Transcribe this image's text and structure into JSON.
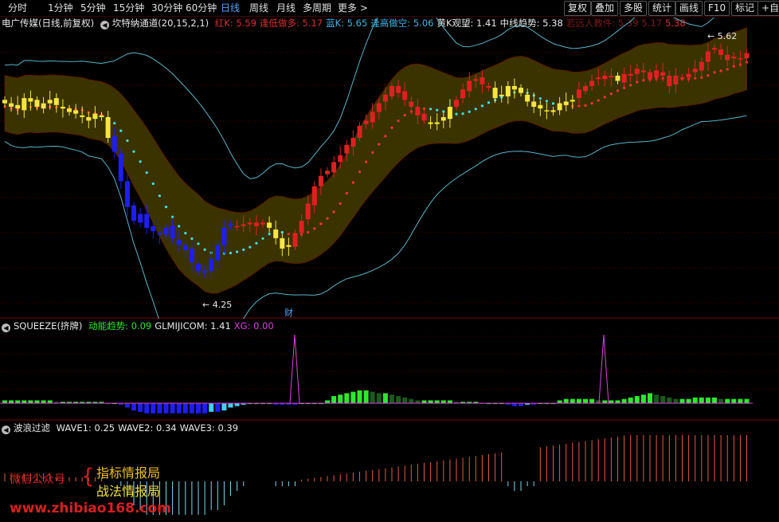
{
  "toolbar": {
    "periods": [
      "分时",
      "1分钟",
      "5分钟",
      "15分钟",
      "30分钟",
      "60分钟",
      "日线",
      "周线",
      "月线",
      "多周期",
      "更多 >"
    ],
    "active_period": "日线",
    "buttons": [
      "复权",
      "叠加",
      "多股",
      "统计",
      "画线",
      "F10",
      "标记",
      "+自选"
    ]
  },
  "main_panel": {
    "stock_title": "电广传媒(日线,前复权)",
    "indicator_name": "坎特纳通道(20,15,2,1)",
    "legend": [
      {
        "label": "红K: 5.59",
        "color": "#d93030"
      },
      {
        "label": "逢低做多: 5.17",
        "color": "#d93030"
      },
      {
        "label": "蓝K: 5.65",
        "color": "#3cb4e6"
      },
      {
        "label": "逢高做空: 5.06",
        "color": "#3cb4e6"
      },
      {
        "label": "黄K观望: 1.41",
        "color": "#e8e8e8"
      },
      {
        "label": "中线趋势: 5.38",
        "color": "#e8e8e8"
      },
      {
        "label": "若远人教件: 5.39",
        "color": "#7a1a1a"
      },
      {
        "label": "5.17",
        "color": "#7a1a1a"
      },
      {
        "label": "5.38",
        "color": "#d93030"
      }
    ],
    "high_label": "5.62",
    "low_label": "4.25",
    "event_marker": "财"
  },
  "squeeze_panel": {
    "title": "SQUEEZE(挤牌)",
    "legend": [
      {
        "label": "动能趋势: 0.09",
        "color": "#2ee82e"
      },
      {
        "label": "GLMIJICOM: 1.41",
        "color": "#e8e8e8"
      },
      {
        "label": "XG: 0.00",
        "color": "#e040e0"
      }
    ]
  },
  "wave_panel": {
    "title": "波浪过滤",
    "legend": [
      {
        "label": "WAVE1: 0.25",
        "color": "#e8e8e8"
      },
      {
        "label": "WAVE2: 0.34",
        "color": "#e8e8e8"
      },
      {
        "label": "WAVE3: 0.39",
        "color": "#e8e8e8"
      }
    ]
  },
  "watermark": {
    "line1_left": "微信公众号",
    "line1_right": "指标情报局",
    "line2_right": "战法情报局",
    "url": "www.zhibiao168.com"
  },
  "colors": {
    "up_red": "#e02020",
    "down_blue": "#1e1ef0",
    "neutral_yellow": "#f5e642",
    "channel_fill": "#3a3300",
    "cyan_line": "#5ab4c8",
    "magenta": "#e040e0",
    "green": "#2ee82e",
    "dark_green": "#1a5a1a",
    "grid_red": "#5a0000"
  },
  "chart_data": {
    "type": "candlestick",
    "price_range": [
      4.1,
      5.75
    ],
    "candles_close": [
      5.3,
      5.28,
      5.27,
      5.33,
      5.31,
      5.28,
      5.3,
      5.32,
      5.29,
      5.27,
      5.25,
      5.24,
      5.22,
      5.2,
      5.24,
      5.22,
      5.1,
      5.02,
      4.85,
      4.7,
      4.62,
      4.66,
      4.58,
      4.56,
      4.54,
      4.58,
      4.52,
      4.48,
      4.45,
      4.38,
      4.33,
      4.32,
      4.4,
      4.48,
      4.58,
      4.6,
      4.59,
      4.6,
      4.6,
      4.61,
      4.6,
      4.58,
      4.52,
      4.46,
      4.48,
      4.55,
      4.62,
      4.72,
      4.82,
      4.88,
      4.91,
      4.96,
      5.0,
      5.06,
      5.1,
      5.17,
      5.2,
      5.25,
      5.3,
      5.35,
      5.4,
      5.36,
      5.32,
      5.28,
      5.23,
      5.2,
      5.18,
      5.19,
      5.22,
      5.28,
      5.32,
      5.38,
      5.43,
      5.44,
      5.41,
      5.39,
      5.33,
      5.35,
      5.4,
      5.38,
      5.36,
      5.31,
      5.28,
      5.27,
      5.26,
      5.25,
      5.3,
      5.31,
      5.32,
      5.38,
      5.4,
      5.43,
      5.45,
      5.46,
      5.45,
      5.43,
      5.47,
      5.46,
      5.5,
      5.48,
      5.44,
      5.49,
      5.46,
      5.4,
      5.46,
      5.45,
      5.47,
      5.5,
      5.54,
      5.6,
      5.62,
      5.58,
      5.55,
      5.57,
      5.56,
      5.59
    ],
    "squeeze_values": [
      0.02,
      0.02,
      0.02,
      0.02,
      0.02,
      0.02,
      0.02,
      0.02,
      0.01,
      0.01,
      0.01,
      0.01,
      0.01,
      0.01,
      0.01,
      0.01,
      0.0,
      0.0,
      -0.01,
      -0.03,
      -0.05,
      -0.06,
      -0.07,
      -0.07,
      -0.07,
      -0.07,
      -0.07,
      -0.07,
      -0.07,
      -0.07,
      -0.07,
      -0.07,
      -0.06,
      -0.06,
      -0.05,
      -0.03,
      -0.02,
      -0.01,
      0.0,
      0.0,
      0.0,
      0.0,
      -0.01,
      -0.01,
      -0.01,
      -0.01,
      0.0,
      0.0,
      0.0,
      0.0,
      0.02,
      0.05,
      0.06,
      0.07,
      0.08,
      0.09,
      0.09,
      0.08,
      0.07,
      0.07,
      0.06,
      0.05,
      0.04,
      0.03,
      0.02,
      0.02,
      0.02,
      0.02,
      0.02,
      0.02,
      0.01,
      0.01,
      0.01,
      0.01,
      0.0,
      0.0,
      0.0,
      0.0,
      -0.01,
      -0.02,
      -0.02,
      -0.01,
      -0.01,
      0.0,
      0.0,
      0.0,
      0.02,
      0.03,
      0.03,
      0.03,
      0.03,
      0.03,
      0.02,
      0.02,
      0.02,
      0.02,
      0.03,
      0.04,
      0.05,
      0.06,
      0.07,
      0.06,
      0.05,
      0.04,
      0.03,
      0.03,
      0.03,
      0.04,
      0.04,
      0.04,
      0.04,
      0.03,
      0.03,
      0.03,
      0.03,
      0.03
    ]
  }
}
